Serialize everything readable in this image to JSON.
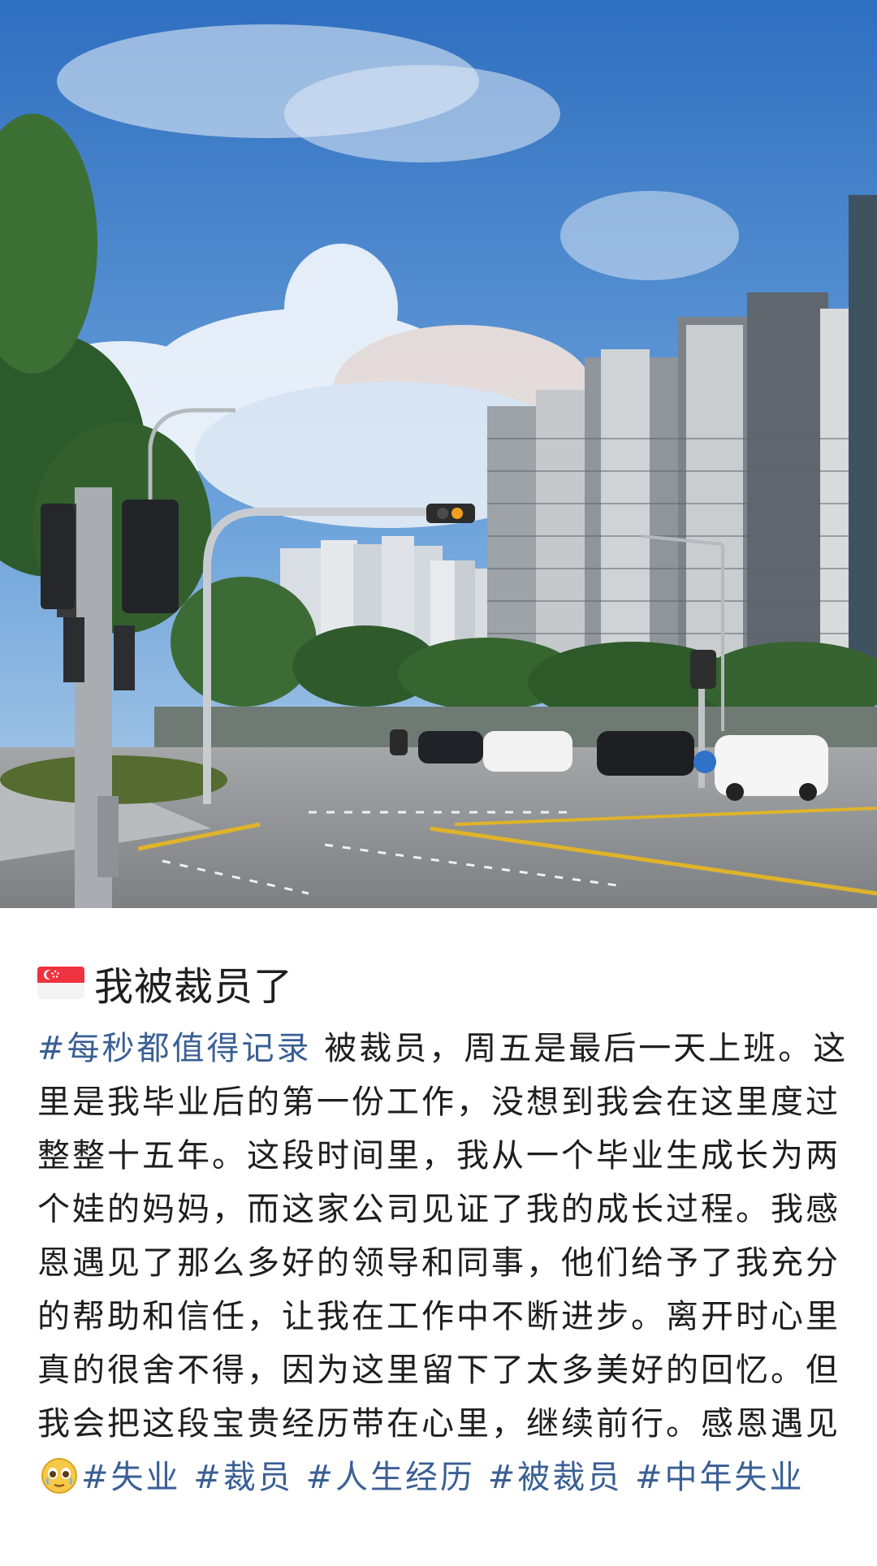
{
  "post": {
    "title": "我被裁员了",
    "flag_icon": "singapore-flag-icon",
    "body_prefix_tag": "#每秒都值得记录",
    "body_text": " 被裁员，周五是最后一天上班。这里是我毕业后的第一份工作，没想到我会在这里度过整整十五年。这段时间里，我从一个毕业生成长为两个娃的妈妈，而这家公司见证了我的成长过程。我感恩遇见了那么多好的领导和同事，他们给予了我充分的帮助和信任，让我在工作中不断进步。离开时心里真的很舍不得，因为这里留下了太多美好的回忆。但我会把这段宝贵经历带在心里，继续前行。感恩遇见",
    "emoji_icon": "teary-smile-emoji-icon",
    "tags": [
      "#失业",
      "#裁员",
      "#人生经历",
      "#被裁员",
      "#中年失业"
    ]
  },
  "colors": {
    "tag": "#3a5f94",
    "text": "#1e1e1e",
    "sky_top": "#2f6fc0",
    "road": "#8c8f93"
  }
}
